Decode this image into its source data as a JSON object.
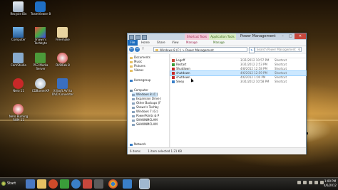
{
  "desktop": {
    "icons": [
      {
        "label": "Recycle Bin",
        "icon": "recycle-bin-icon"
      },
      {
        "label": "TeamViewer 8",
        "icon": "teamviewer-icon"
      },
      {
        "label": "Computer",
        "icon": "computer-icon"
      },
      {
        "label": "Shawn's Techbyte",
        "icon": "folder-icon"
      },
      {
        "label": "Freemake",
        "icon": "freemake-icon"
      },
      {
        "label": "CamStudio",
        "icon": "camstudio-icon"
      },
      {
        "label": "PS3 Media Server",
        "icon": "ps3-media-server-icon"
      },
      {
        "label": "DVDFab 8",
        "icon": "dvdfab-icon"
      },
      {
        "label": "Nero 11",
        "icon": "nero-icon"
      },
      {
        "label": "CDBurnerXP",
        "icon": "cdburnerxp-icon"
      },
      {
        "label": "Xilisoft AVI to DVD Converter",
        "icon": "xilisoft-icon"
      },
      {
        "label": "Nero Burning ROM 11",
        "icon": "nero-burning-rom-icon"
      }
    ]
  },
  "window": {
    "title": "Power Management",
    "contextual_tabs": {
      "shortcut": "Shortcut Tools",
      "application": "Application Tools"
    },
    "ribbon_tabs": [
      "File",
      "Home",
      "Share",
      "View",
      "Manage",
      "Manage"
    ],
    "address": "Windows 8 (C:) > Power Management",
    "search_placeholder": "Search Power Management",
    "nav": {
      "items": [
        {
          "label": "Documents",
          "color": "#e6c063"
        },
        {
          "label": "Music",
          "color": "#e6c063"
        },
        {
          "label": "Pictures",
          "color": "#e6c063"
        },
        {
          "label": "Videos",
          "color": "#e6c063"
        },
        {
          "label": "Homegroup",
          "color": "#3a7fc8"
        },
        {
          "label": "Computer",
          "color": "#6b879e"
        },
        {
          "label": "Windows 8 (C:)",
          "color": "#8aa3bd",
          "selected": true
        },
        {
          "label": "Expansion Drive (",
          "color": "#8aa3bd"
        },
        {
          "label": "Other Backups (F",
          "color": "#8aa3bd"
        },
        {
          "label": "Shawn's Techby",
          "color": "#8aa3bd"
        },
        {
          "label": "Windows 7 (G:)",
          "color": "#8aa3bd"
        },
        {
          "label": "PowerPoints & P",
          "color": "#8aa3bd"
        },
        {
          "label": "SHAWNMCLAM",
          "color": "#8aa3bd"
        },
        {
          "label": "SHAWNMCLAM",
          "color": "#8aa3bd"
        },
        {
          "label": "Network",
          "color": "#3a7fc8"
        }
      ]
    },
    "files": [
      {
        "name": "Logoff",
        "date": "3/31/2012 10:57 PM",
        "type": "Shortcut"
      },
      {
        "name": "Restart",
        "date": "3/31/2012 2:53 PM",
        "type": "Shortcut"
      },
      {
        "name": "Shutdown",
        "date": "4/8/2012 12:58 PM",
        "type": "Shortcut"
      },
      {
        "name": "shutdown",
        "date": "4/6/2012 12:59 PM",
        "type": "Shortcut",
        "selected": true
      },
      {
        "name": "shutdown",
        "date": "4/6/2012 1:00 PM",
        "type": "Shortcut"
      },
      {
        "name": "Sleep",
        "date": "3/31/2012 10:58 PM",
        "type": "Shortcut"
      }
    ],
    "status": {
      "count": "6 items",
      "selected": "1 item selected 1.21 KB"
    }
  },
  "taskbar": {
    "start_label": "Start",
    "pinned": [
      {
        "icon": "windows-orb-icon",
        "color": "#4a79c2"
      },
      {
        "icon": "folder-icon",
        "color": "#e6c063"
      },
      {
        "icon": "media-icon",
        "color": "#d04a2a"
      },
      {
        "icon": "settings-icon",
        "color": "#3a9d3a"
      },
      {
        "icon": "browser-icon",
        "color": "#3a7fc8"
      },
      {
        "icon": "app-icon",
        "color": "#c7473c"
      },
      {
        "icon": "app-icon",
        "color": "#5b5b5b"
      },
      {
        "icon": "chrome-icon",
        "color": "#e8b62c"
      },
      {
        "icon": "app-icon",
        "color": "#3a7fc8"
      },
      {
        "icon": "explorer-icon",
        "color": "#a0b8d0"
      }
    ],
    "clock": {
      "time": "1:00 PM",
      "date": "4/6/2012"
    }
  }
}
